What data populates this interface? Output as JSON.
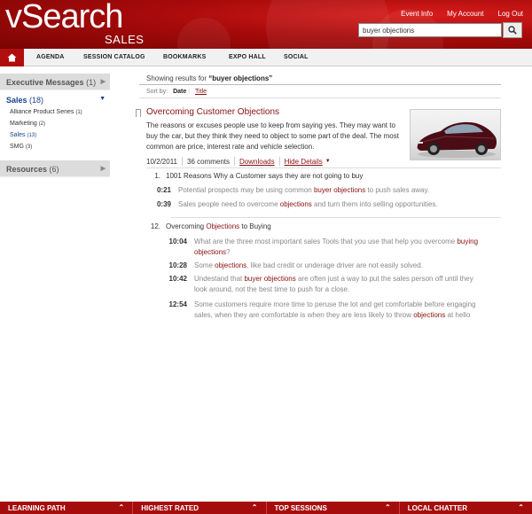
{
  "app": {
    "logo_main": "vSearch",
    "logo_sub": "SALES",
    "links": [
      "Event Info",
      "My Account",
      "Log Out"
    ]
  },
  "search": {
    "value": "buyer objections"
  },
  "nav": {
    "items": [
      "AGENDA",
      "SESSION CATALOG",
      "BOOKMARKS",
      "EXPO HALL",
      "SOCIAL"
    ]
  },
  "sidebar": {
    "sections": [
      {
        "label": "Executive Messages",
        "count": "(1)"
      },
      {
        "label": "Sales",
        "count": "(18)"
      },
      {
        "label": "Resources",
        "count": "(6)"
      }
    ],
    "subitems": [
      {
        "label": "Alliance Product Series",
        "count": "(1)"
      },
      {
        "label": "Marketing",
        "count": "(2)"
      },
      {
        "label": "Sales",
        "count": "(13)"
      },
      {
        "label": "SMG",
        "count": "(3)"
      }
    ]
  },
  "results": {
    "prefix": "Showing results for",
    "query": "“buyer objections”",
    "sort_label": "Sort by:",
    "sort_date": "Date",
    "sort_title": "Title"
  },
  "result": {
    "title": "Overcoming Customer Objections",
    "description": "The reasons or excuses people use to keep from saying yes. They may want to buy the car, but they think they need to object to some part of the deal. The most common are price, interest rate and vehicle selection.",
    "date": "10/2/2011",
    "comments": "36 comments",
    "downloads": "Downloads",
    "hide_details": "Hide Details",
    "items": [
      {
        "number": "1.",
        "title": "1001 Reasons Why a Customer says they are not going to buy",
        "segments": [
          {
            "time": "0:21",
            "pre": "Potential prospects may be using common ",
            "hl": "buyer objections",
            "post": " to push sales away."
          },
          {
            "time": "0:39",
            "pre": "Sales people need to overcome ",
            "hl": "objections",
            "post": " and turn them into selling opportunities."
          }
        ]
      },
      {
        "number": "12.",
        "title_pre": "Overcoming ",
        "title_hl": "Objections",
        "title_post": " to Buying",
        "segments": [
          {
            "time": "10:04",
            "pre": "What are the three most important sales Tools that you use that help you overcome ",
            "hl": "buying objections",
            "post": "?"
          },
          {
            "time": "10:28",
            "pre": "Some ",
            "hl": "objections",
            "post": ", like bad credit or underage driver are not easily solved."
          },
          {
            "time": "10:42",
            "pre": "Undestand that ",
            "hl": "buyer objections",
            "post": " are often just a way to put the sales person off until they look around, not the best time to push for a close."
          },
          {
            "time": "12:54",
            "pre": "Some customers require more time to peruse the lot and get comfortable before engaging sales, when they are comfortable is when they are less likely to throw ",
            "hl": "objections",
            "post": " at hello"
          }
        ]
      }
    ]
  },
  "footer": {
    "items": [
      "LEARNING PATH",
      "HIGHEST RATED",
      "TOP SESSIONS",
      "LOCAL CHATTER"
    ]
  },
  "colors": {
    "brand_red": "#a50d0d",
    "link_red": "#8b0f0f",
    "active_blue": "#1a3f8f"
  }
}
